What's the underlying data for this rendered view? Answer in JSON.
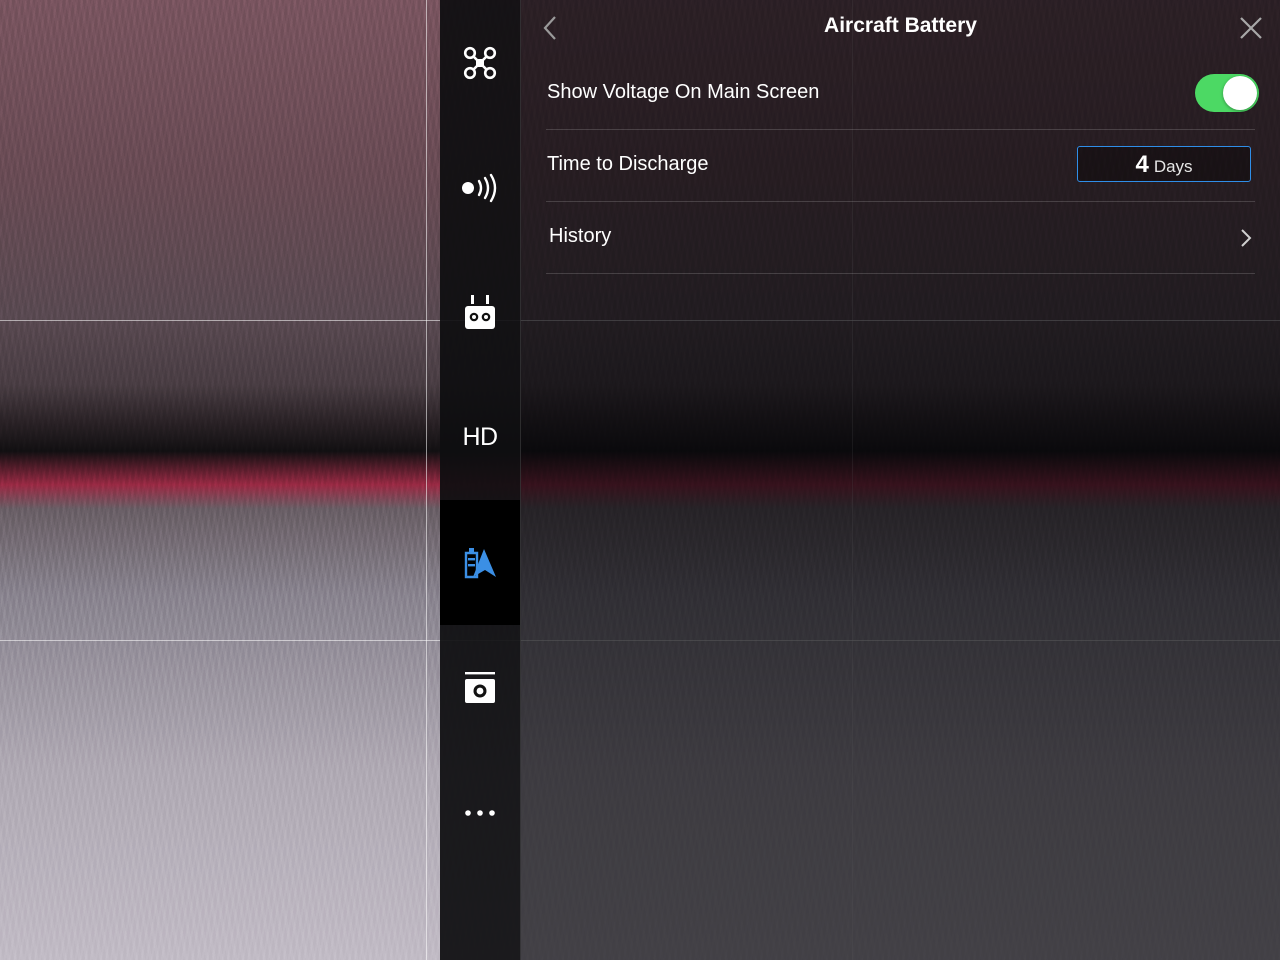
{
  "panel": {
    "title": "Aircraft Battery"
  },
  "settings": {
    "show_voltage": {
      "label": "Show Voltage On Main Screen",
      "enabled": true
    },
    "time_to_discharge": {
      "label": "Time to Discharge",
      "value": "4",
      "unit": "Days"
    },
    "history": {
      "label": "History"
    }
  },
  "sidebar": {
    "items": [
      {
        "name": "aircraft-icon"
      },
      {
        "name": "signal-icon"
      },
      {
        "name": "remote-controller-icon"
      },
      {
        "name": "hd-transmission-icon",
        "text": "HD"
      },
      {
        "name": "battery-icon",
        "active": true
      },
      {
        "name": "camera-icon"
      },
      {
        "name": "more-icon"
      }
    ]
  },
  "colors": {
    "accent_blue": "#2f8ee8",
    "toggle_green": "#4cd964",
    "active_icon": "#3b8fe5"
  }
}
